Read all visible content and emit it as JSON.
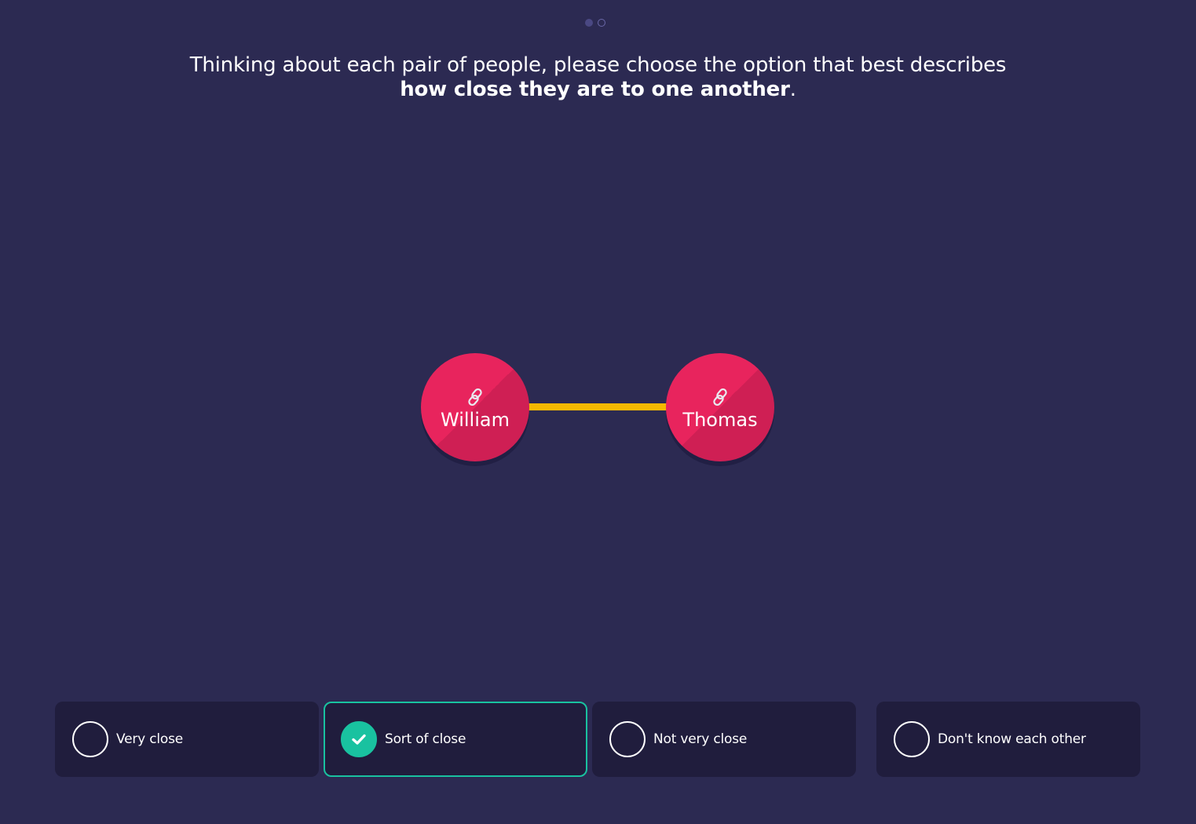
{
  "pager": {
    "total": 2,
    "current": 1
  },
  "prompt": {
    "text_before": "Thinking about each pair of people, please choose the option that best describes",
    "text_bold": "how close they are to one another",
    "text_after": "."
  },
  "network": {
    "nodes": [
      {
        "label": "William",
        "icon": "link-icon"
      },
      {
        "label": "Thomas",
        "icon": "link-icon"
      }
    ],
    "edge_color": "#f5b800",
    "node_color": "#e8245d"
  },
  "options": [
    {
      "label": "Very close",
      "selected": false
    },
    {
      "label": "Sort of close",
      "selected": true
    },
    {
      "label": "Not very close",
      "selected": false
    },
    {
      "label": "Don't know each other",
      "selected": false
    }
  ],
  "colors": {
    "background": "#2c2a52",
    "card": "#201d3d",
    "accent": "#19c2a0"
  }
}
